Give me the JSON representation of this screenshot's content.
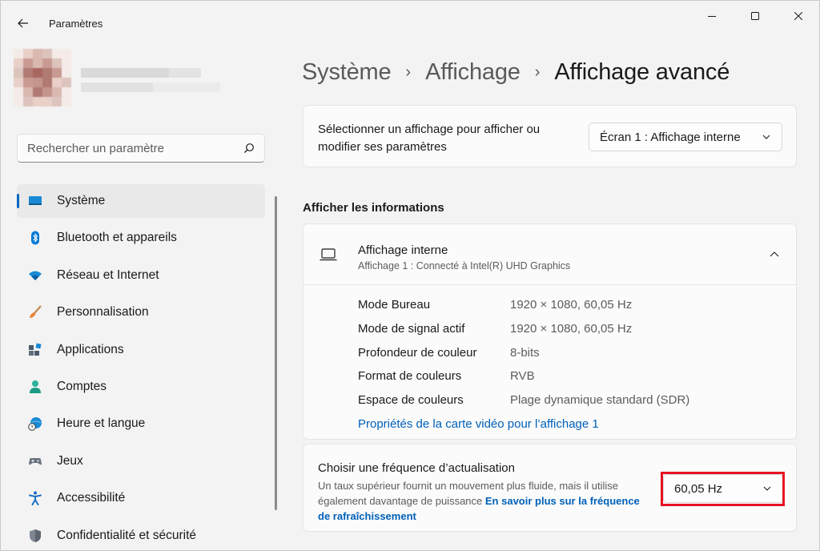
{
  "window": {
    "title": "Paramètres",
    "controls": {
      "minimize_icon": "minimize-icon",
      "maximize_icon": "maximize-icon",
      "close_icon": "close-icon"
    }
  },
  "search": {
    "placeholder": "Rechercher un paramètre",
    "value": ""
  },
  "sidebar": {
    "items": [
      {
        "label": "Système",
        "icon": "display-icon",
        "active": true
      },
      {
        "label": "Bluetooth et appareils",
        "icon": "bluetooth-icon"
      },
      {
        "label": "Réseau et Internet",
        "icon": "wifi-icon"
      },
      {
        "label": "Personnalisation",
        "icon": "brush-icon"
      },
      {
        "label": "Applications",
        "icon": "apps-icon"
      },
      {
        "label": "Comptes",
        "icon": "person-icon"
      },
      {
        "label": "Heure et langue",
        "icon": "globe-clock-icon"
      },
      {
        "label": "Jeux",
        "icon": "gamepad-icon"
      },
      {
        "label": "Accessibilité",
        "icon": "accessibility-icon"
      },
      {
        "label": "Confidentialité et sécurité",
        "icon": "shield-icon"
      }
    ]
  },
  "breadcrumb": [
    "Système",
    "Affichage",
    "Affichage avancé"
  ],
  "display_select": {
    "label": "Sélectionner un affichage pour afficher ou modifier ses paramètres",
    "selected": "Écran 1 : Affichage interne"
  },
  "info_section": {
    "title": "Afficher les informations",
    "display_name": "Affichage interne",
    "display_sub": "Affichage 1 : Connecté à Intel(R) UHD Graphics",
    "rows": [
      {
        "key": "Mode Bureau",
        "value": "1920 × 1080, 60,05 Hz"
      },
      {
        "key": "Mode de signal actif",
        "value": "1920 × 1080, 60,05 Hz"
      },
      {
        "key": "Profondeur de couleur",
        "value": "8-bits"
      },
      {
        "key": "Format de couleurs",
        "value": "RVB"
      },
      {
        "key": "Espace de couleurs",
        "value": "Plage dynamique standard (SDR)"
      }
    ],
    "link": "Propriétés de la carte vidéo pour l’affichage 1"
  },
  "refresh": {
    "title": "Choisir une fréquence d’actualisation",
    "desc": "Un taux supérieur fournit un mouvement plus fluide, mais il utilise également davantage de puissance",
    "link": "En savoir plus sur la fréquence de rafraîchissement",
    "selected": "60,05 Hz"
  },
  "colors": {
    "accent": "#0067c0",
    "link": "#0060b8",
    "highlight": "#e81123"
  }
}
